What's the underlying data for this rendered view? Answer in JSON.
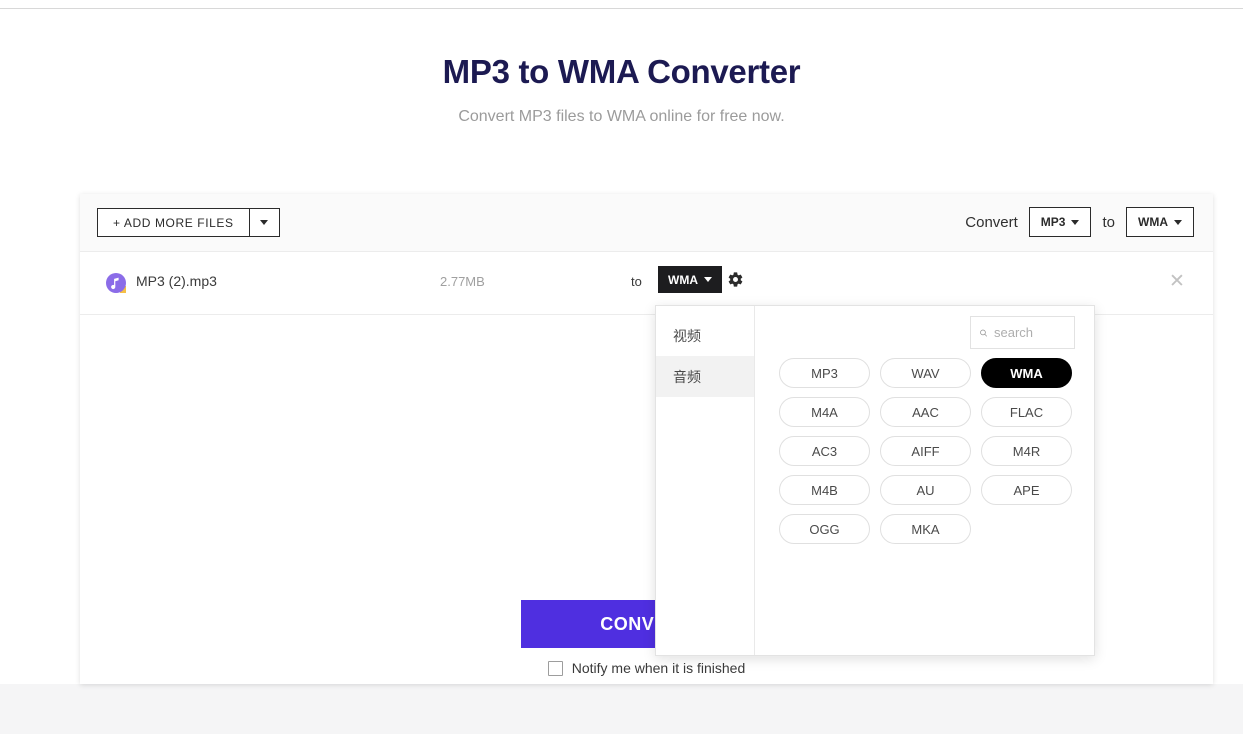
{
  "hero": {
    "title": "MP3 to WMA Converter",
    "subtitle": "Convert MP3 files to WMA online for free now."
  },
  "toolbar": {
    "add_files_label": "+ ADD MORE FILES",
    "add_files_caret_icon": "chevron-down-icon",
    "convert_label": "Convert",
    "source_format": "MP3",
    "to_label": "to",
    "target_format": "WMA"
  },
  "file_row": {
    "icon": "music-file-icon",
    "name": "MP3 (2).mp3",
    "size": "2.77MB",
    "to_label": "to",
    "format": "WMA",
    "settings_icon": "gear-icon",
    "remove_icon": "close-icon"
  },
  "convert_area": {
    "convert_button_label": "CONVERT",
    "notify_label": "Notify me when it is finished",
    "notify_checked": false
  },
  "format_panel": {
    "categories": [
      {
        "label": "视频",
        "active": false
      },
      {
        "label": "音频",
        "active": true
      }
    ],
    "search": {
      "icon": "search-icon",
      "placeholder": "search",
      "value": ""
    },
    "selected_format": "WMA",
    "formats": [
      "MP3",
      "WAV",
      "WMA",
      "M4A",
      "AAC",
      "FLAC",
      "AC3",
      "AIFF",
      "M4R",
      "M4B",
      "AU",
      "APE",
      "OGG",
      "MKA"
    ]
  },
  "colors": {
    "title": "#1c1a52",
    "convert_button": "#4f2fe0",
    "selected_pill": "#000000",
    "file_icon": "#8b6ce8"
  }
}
